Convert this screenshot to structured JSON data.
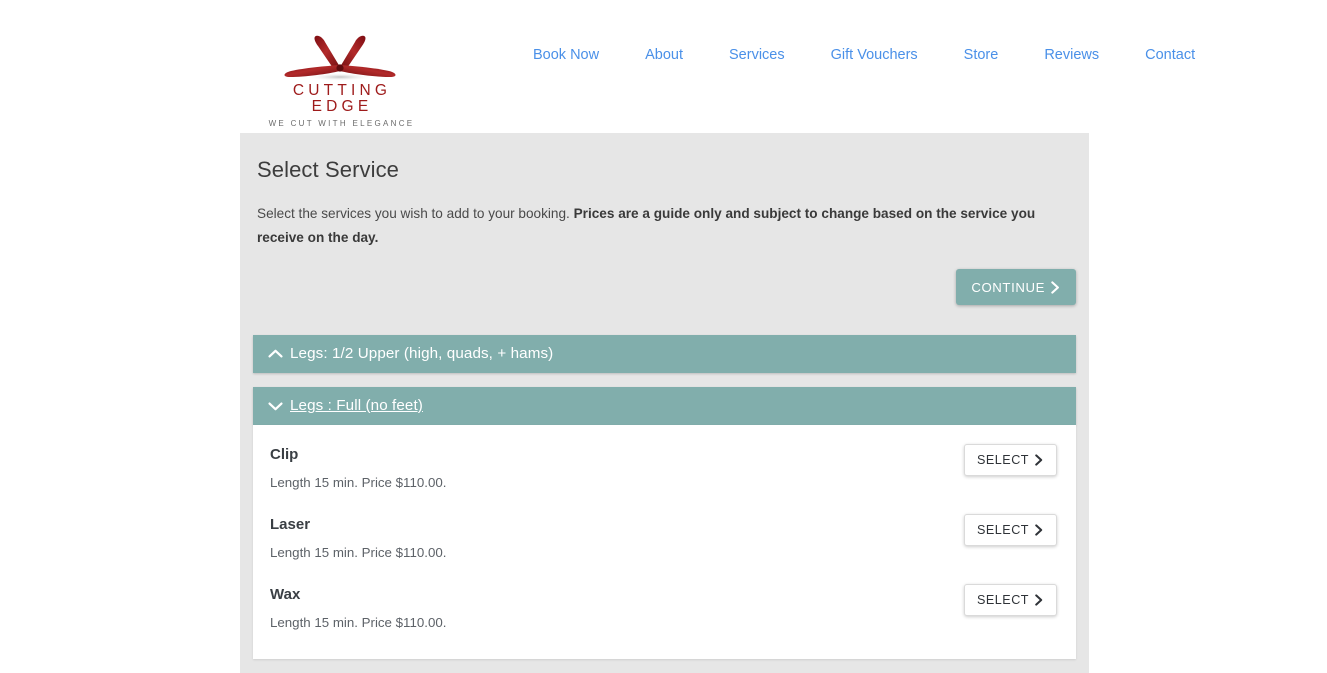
{
  "brand": {
    "name": "CUTTING EDGE",
    "tagline": "WE CUT WITH ELEGANCE",
    "logo_icon": "scissors-logo-icon",
    "logo_color": "#9e1b1b"
  },
  "nav": {
    "links": [
      {
        "label": "Book Now"
      },
      {
        "label": "About"
      },
      {
        "label": "Services"
      },
      {
        "label": "Gift Vouchers"
      },
      {
        "label": "Store"
      },
      {
        "label": "Reviews"
      },
      {
        "label": "Contact"
      }
    ],
    "link_color": "#4a90e8"
  },
  "panel": {
    "title": "Select Service",
    "desc_plain": "Select the services you wish to add to your booking. ",
    "desc_bold": "Prices are a guide only and subject to change based on the service you receive on the day.",
    "continue_label": "CONTINUE",
    "continue_icon": "chevron-right-icon",
    "background_color": "#e6e6e6",
    "accent_color": "#81aeac"
  },
  "accordion": {
    "sections": [
      {
        "title": "Legs: 1/2 Upper (high, quads, + hams)",
        "caret_icon": "chevron-up-icon",
        "state": "collapsed",
        "services": []
      },
      {
        "title": "Legs : Full (no feet)",
        "caret_icon": "chevron-down-icon",
        "state": "expanded",
        "services": [
          {
            "name": "Clip",
            "meta": "Length 15 min. Price $110.00.",
            "select_label": "SELECT",
            "select_icon": "chevron-right-icon"
          },
          {
            "name": "Laser",
            "meta": "Length 15 min. Price $110.00.",
            "select_label": "SELECT",
            "select_icon": "chevron-right-icon"
          },
          {
            "name": "Wax",
            "meta": "Length 15 min. Price $110.00.",
            "select_label": "SELECT",
            "select_icon": "chevron-right-icon"
          }
        ]
      }
    ]
  }
}
